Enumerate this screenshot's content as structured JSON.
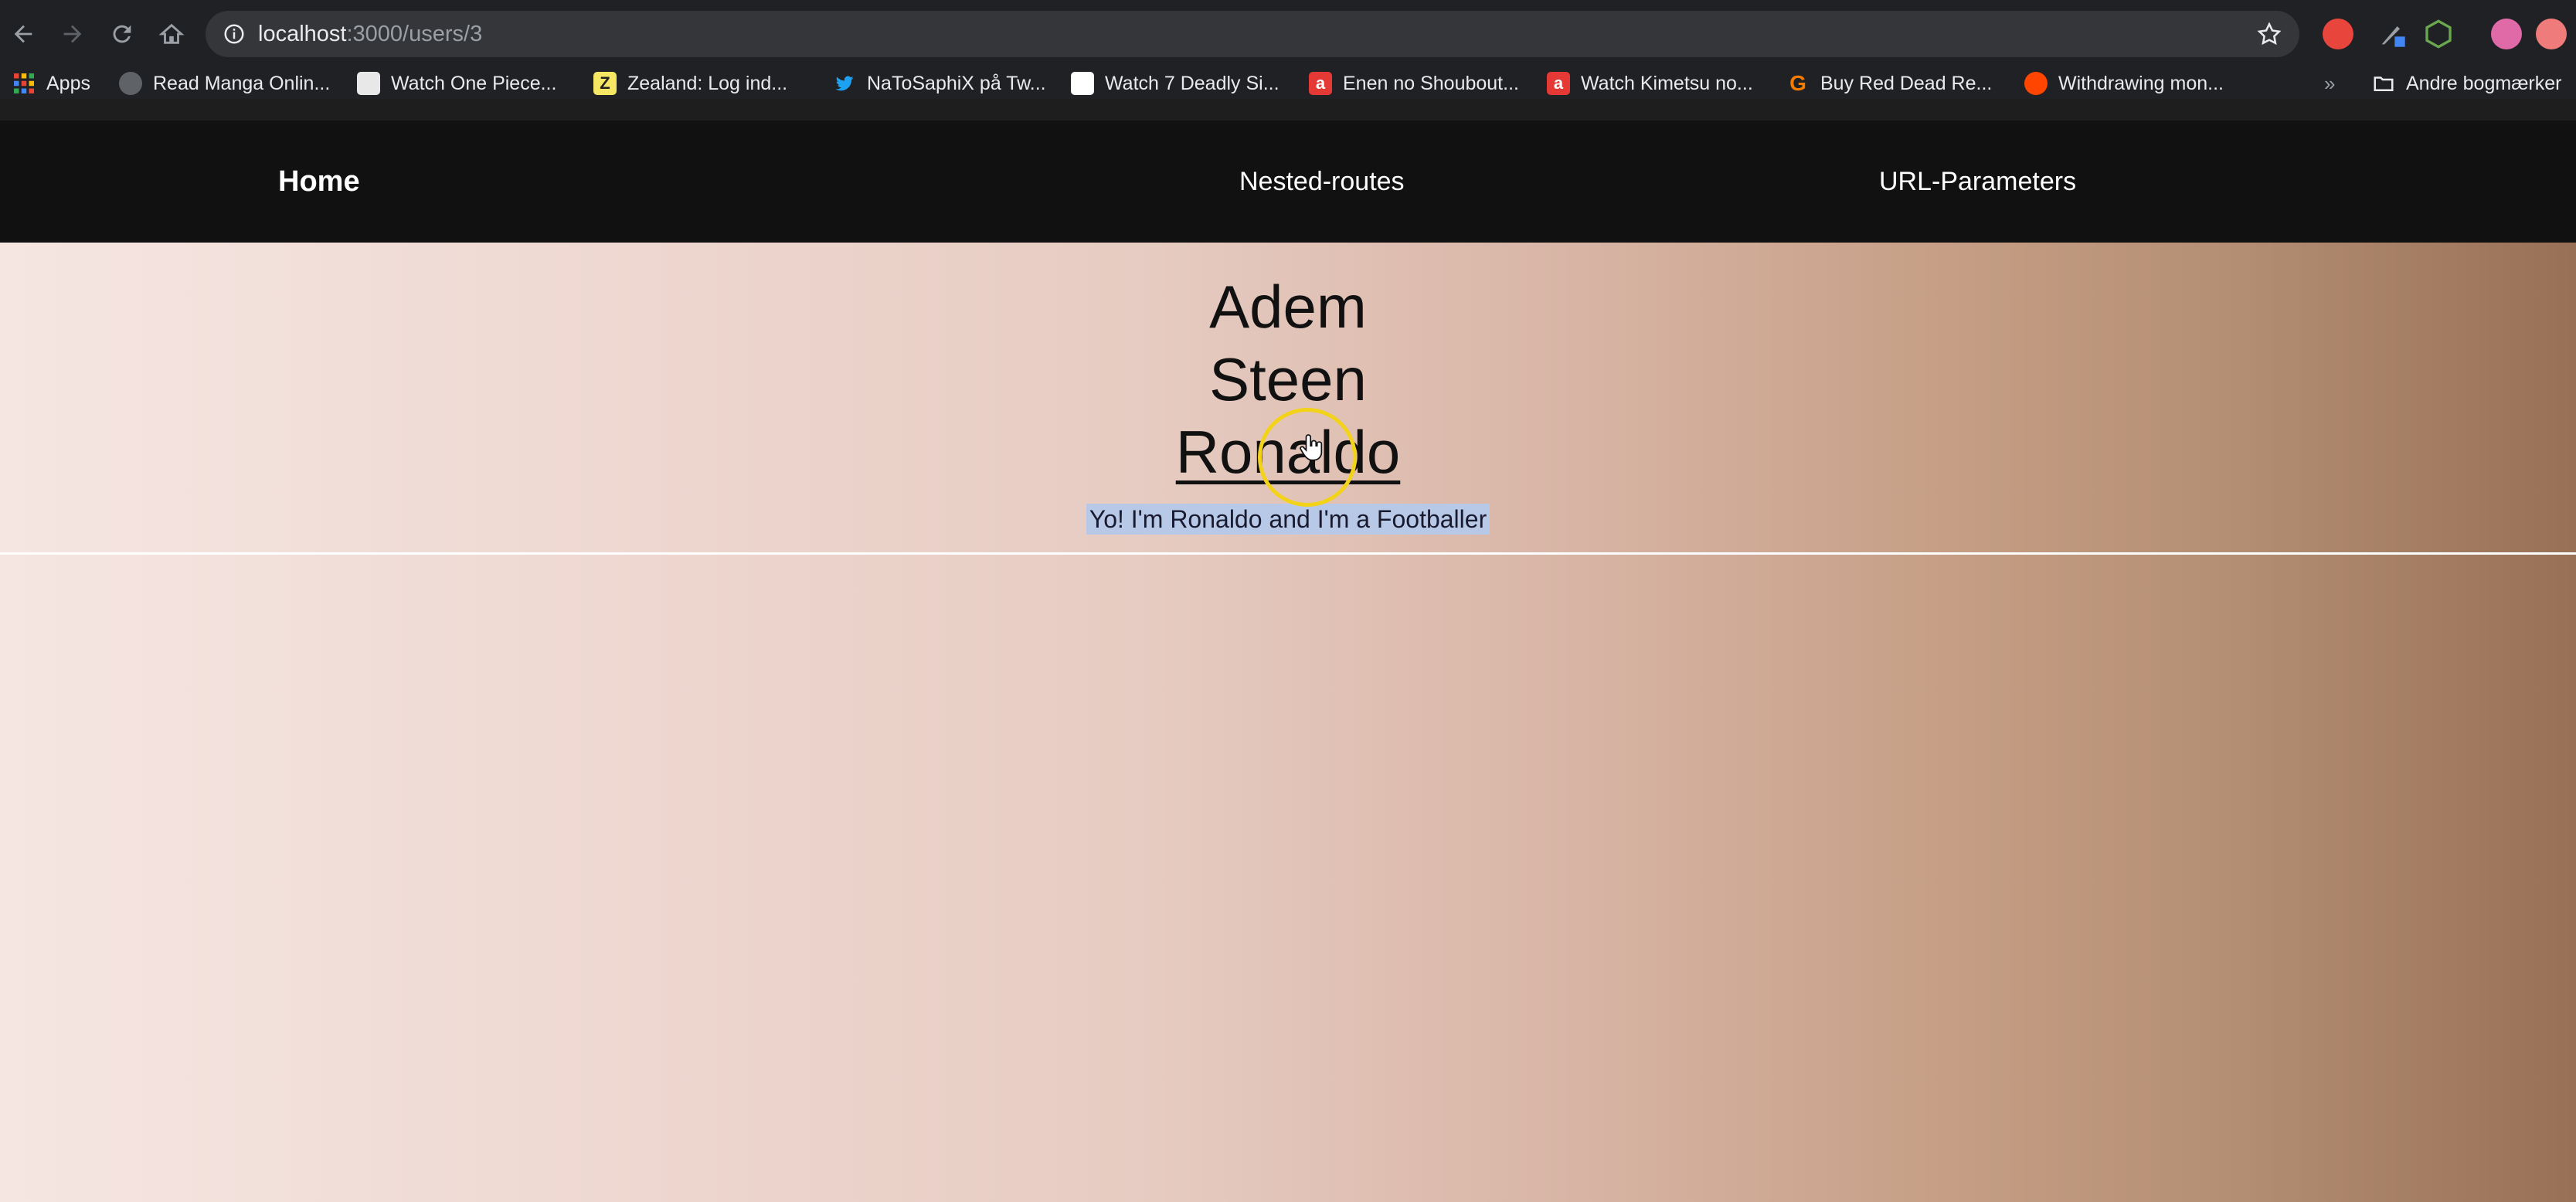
{
  "browser": {
    "url_host": "localhost",
    "url_path": ":3000/users/3",
    "bookmarks": [
      {
        "label": "Apps",
        "icon": "apps-grid-icon",
        "color": "#ea4335"
      },
      {
        "label": "Read Manga Onlin...",
        "icon": "globe-icon",
        "color": "#9aa0a6"
      },
      {
        "label": "Watch One Piece...",
        "icon": "one-piece-favicon",
        "color": "#e8e8e8"
      },
      {
        "label": "Zealand: Log ind...",
        "icon": "zealand-favicon",
        "color": "#f5e663"
      },
      {
        "label": "NaToSaphiX på Tw...",
        "icon": "twitter-bird-icon",
        "color": "#1da1f2"
      },
      {
        "label": "Watch 7 Deadly Si...",
        "icon": "seven-deadly-favicon",
        "color": "#ffffff"
      },
      {
        "label": "Enen no Shoubout...",
        "icon": "animelab-favicon",
        "color": "#e53935"
      },
      {
        "label": "Watch Kimetsu no...",
        "icon": "animelab-favicon",
        "color": "#e53935"
      },
      {
        "label": "Buy Red Dead Re...",
        "icon": "g2a-favicon",
        "color": "#f57c00"
      },
      {
        "label": "Withdrawing mon...",
        "icon": "reddit-favicon",
        "color": "#ff4500"
      }
    ],
    "bookmarks_more": "»",
    "other_bookmarks": "Andre bogmærker"
  },
  "nav": {
    "home": "Home",
    "nested": "Nested-routes",
    "params": "URL-Parameters"
  },
  "users": {
    "names": [
      "Adem",
      "Steen",
      "Ronaldo"
    ],
    "active": "Ronaldo",
    "bio": "Yo! I'm Ronaldo and I'm a Footballer"
  },
  "colors": {
    "navbar": "#111111",
    "gradient_start": "#f5e6e2",
    "gradient_end": "#977055",
    "cursor_ring": "#f3d21a",
    "selection": "#b8c9e8"
  }
}
